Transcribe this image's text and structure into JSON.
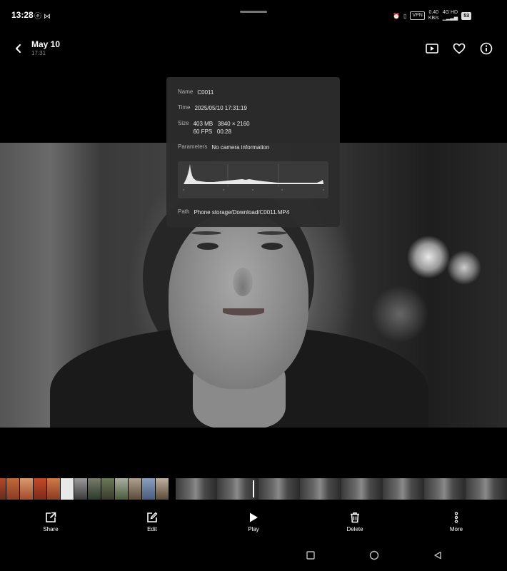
{
  "status_bar": {
    "time": "13:28",
    "left_icons": [
      "notification-icon",
      "mail-icon"
    ],
    "vpn": "VPN",
    "net_speed_value": "0.40",
    "net_speed_unit": "KB/s",
    "network": "4G HD",
    "battery": "53"
  },
  "header": {
    "date": "May 10",
    "time": "17:31",
    "icons": [
      "back-icon",
      "slideshow-icon",
      "favorite-icon",
      "info-icon"
    ]
  },
  "info_panel": {
    "name_label": "Name",
    "name": "C0011",
    "time_label": "Time",
    "time": "2025/05/10 17:31:19",
    "size_label": "Size",
    "size_line1": "403 MB   3840 × 2160",
    "size_line2": "60 FPS   00:28",
    "params_label": "Parameters",
    "params": "No camera information",
    "path_label": "Path",
    "path": "Phone storage/Download/C0011.MP4"
  },
  "toolbar": {
    "share": "Share",
    "edit": "Edit",
    "play": "Play",
    "delete": "Delete",
    "more": "More"
  },
  "colors": {
    "background": "#000000",
    "panel": "#2c2c2c"
  }
}
